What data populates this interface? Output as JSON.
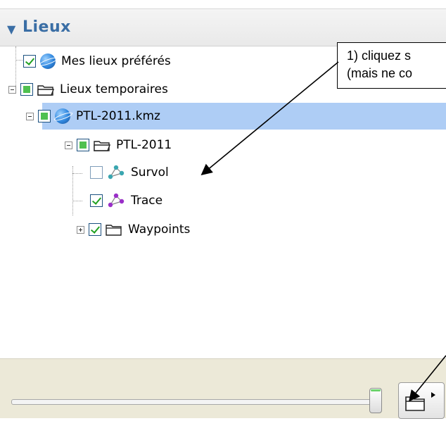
{
  "panel": {
    "title": "Lieux"
  },
  "tree": {
    "items": [
      {
        "label": "Mes lieux préférés"
      },
      {
        "label": "Lieux temporaires"
      },
      {
        "label": "PTL-2011.kmz"
      },
      {
        "label": "PTL-2011"
      },
      {
        "label": "Survol"
      },
      {
        "label": "Trace"
      },
      {
        "label": "Waypoints"
      }
    ]
  },
  "callout": {
    "line1": "1) cliquez s",
    "line2": "(mais ne co"
  },
  "colors": {
    "header_text": "#3a6ea5",
    "selection": "#aecdf5",
    "check_green": "#21a121",
    "survol_icon": "#3aa6b0",
    "trace_icon": "#9a2fc8"
  },
  "icons": [
    "triangle-down-icon",
    "earth-globe-icon",
    "folder-icon",
    "network-path-icon",
    "folder-menu-icon"
  ]
}
